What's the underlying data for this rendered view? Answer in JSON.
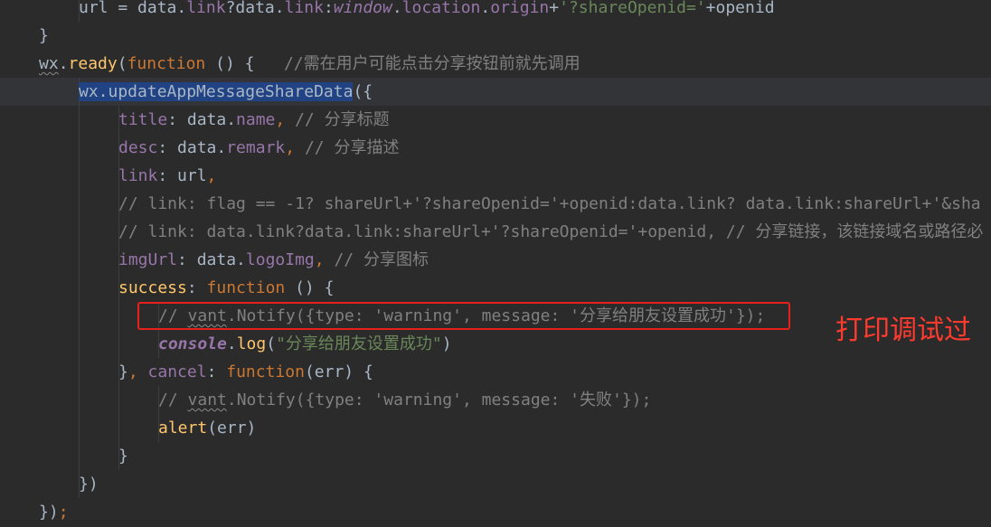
{
  "editor": {
    "theme_colors": {
      "background": "#2b2b2b",
      "keyword": "#cc7832",
      "property": "#9876aa",
      "function": "#ffc66d",
      "string": "#6a8759",
      "comment": "#808080",
      "default": "#a9b7c6",
      "selection": "#214283"
    },
    "lines": [
      {
        "indent": 2,
        "tokens": [
          {
            "t": "url = data.",
            "c": "default"
          },
          {
            "t": "link",
            "c": "prop"
          },
          {
            "t": "?data.",
            "c": "default"
          },
          {
            "t": "link",
            "c": "prop"
          },
          {
            "t": ":",
            "c": "default"
          },
          {
            "t": "window",
            "c": "prop",
            "s": "italic"
          },
          {
            "t": ".",
            "c": "default"
          },
          {
            "t": "location",
            "c": "prop"
          },
          {
            "t": ".",
            "c": "default"
          },
          {
            "t": "origin",
            "c": "prop"
          },
          {
            "t": "+",
            "c": "default"
          },
          {
            "t": "'?shareOpenid='",
            "c": "str"
          },
          {
            "t": "+openid",
            "c": "default"
          }
        ]
      },
      {
        "indent": 1,
        "tokens": [
          {
            "t": "}",
            "c": "default"
          }
        ]
      },
      {
        "indent": 1,
        "tokens": [
          {
            "t": "wx",
            "c": "default",
            "s": "squiggle"
          },
          {
            "t": ".",
            "c": "default"
          },
          {
            "t": "ready",
            "c": "func"
          },
          {
            "t": "(",
            "c": "default"
          },
          {
            "t": "function",
            "c": "kw"
          },
          {
            "t": " () {   ",
            "c": "default"
          },
          {
            "t": "//需在用户可能点击分享按钮前就先调用",
            "c": "com"
          }
        ]
      },
      {
        "indent": 2,
        "highlight": true,
        "tokens": [
          {
            "t": "wx.updateAppMessageShareData",
            "c": "default",
            "s": "sel"
          },
          {
            "t": "({",
            "c": "default"
          }
        ]
      },
      {
        "indent": 3,
        "tokens": [
          {
            "t": "title",
            "c": "prop"
          },
          {
            "t": ": data.",
            "c": "default"
          },
          {
            "t": "name",
            "c": "prop"
          },
          {
            "t": ", ",
            "c": "kw"
          },
          {
            "t": "// 分享标题",
            "c": "com"
          }
        ]
      },
      {
        "indent": 3,
        "tokens": [
          {
            "t": "desc",
            "c": "prop"
          },
          {
            "t": ": data.",
            "c": "default"
          },
          {
            "t": "remark",
            "c": "prop"
          },
          {
            "t": ", ",
            "c": "kw"
          },
          {
            "t": "// 分享描述",
            "c": "com"
          }
        ]
      },
      {
        "indent": 3,
        "tokens": [
          {
            "t": "link",
            "c": "prop"
          },
          {
            "t": ": url",
            "c": "default"
          },
          {
            "t": ",",
            "c": "kw"
          }
        ]
      },
      {
        "indent": 3,
        "tokens": [
          {
            "t": "// link: flag == -1? shareUrl+'?shareOpenid='+openid:data.link? data.link:shareUrl+'&sha",
            "c": "com"
          }
        ]
      },
      {
        "indent": 3,
        "tokens": [
          {
            "t": "// link: data.link?data.link:shareUrl+'?shareOpenid='+openid, // 分享链接，该链接域名或路径必",
            "c": "com"
          }
        ]
      },
      {
        "indent": 3,
        "tokens": [
          {
            "t": "imgUrl",
            "c": "prop"
          },
          {
            "t": ": data.",
            "c": "default"
          },
          {
            "t": "logoImg",
            "c": "prop"
          },
          {
            "t": ", ",
            "c": "kw"
          },
          {
            "t": "// 分享图标",
            "c": "com"
          }
        ]
      },
      {
        "indent": 3,
        "tokens": [
          {
            "t": "success",
            "c": "func"
          },
          {
            "t": ": ",
            "c": "default"
          },
          {
            "t": "function",
            "c": "kw"
          },
          {
            "t": " () {",
            "c": "default"
          }
        ]
      },
      {
        "indent": 4,
        "tokens": [
          {
            "t": "// ",
            "c": "com"
          },
          {
            "t": "vant",
            "c": "com",
            "s": "squiggle"
          },
          {
            "t": ".Notify({type: 'warning', message: '分享给朋友设置成功'});",
            "c": "com"
          }
        ]
      },
      {
        "indent": 4,
        "tokens": [
          {
            "t": "console",
            "c": "prop",
            "s": "bolditalic"
          },
          {
            "t": ".",
            "c": "default"
          },
          {
            "t": "log",
            "c": "func"
          },
          {
            "t": "(",
            "c": "default"
          },
          {
            "t": "\"分享给朋友设置成功\"",
            "c": "str"
          },
          {
            "t": ")",
            "c": "default"
          }
        ]
      },
      {
        "indent": 3,
        "tokens": [
          {
            "t": "}",
            "c": "default"
          },
          {
            "t": ", ",
            "c": "kw"
          },
          {
            "t": "cancel",
            "c": "prop"
          },
          {
            "t": ": ",
            "c": "default"
          },
          {
            "t": "function",
            "c": "kw"
          },
          {
            "t": "(err) {",
            "c": "default"
          }
        ]
      },
      {
        "indent": 4,
        "tokens": [
          {
            "t": "// ",
            "c": "com"
          },
          {
            "t": "vant",
            "c": "com",
            "s": "squiggle"
          },
          {
            "t": ".Notify({type: 'warning', message: '失败'});",
            "c": "com"
          }
        ]
      },
      {
        "indent": 4,
        "tokens": [
          {
            "t": "alert",
            "c": "func"
          },
          {
            "t": "(err)",
            "c": "default"
          }
        ]
      },
      {
        "indent": 3,
        "tokens": [
          {
            "t": "}",
            "c": "default"
          }
        ]
      },
      {
        "indent": 2,
        "tokens": [
          {
            "t": "})",
            "c": "default"
          }
        ]
      },
      {
        "indent": 1,
        "tokens": [
          {
            "t": "})",
            "c": "default"
          },
          {
            "t": ";",
            "c": "kw"
          }
        ]
      }
    ]
  },
  "annotation": {
    "text": "打印调试过",
    "color": "#ff3b2f"
  }
}
